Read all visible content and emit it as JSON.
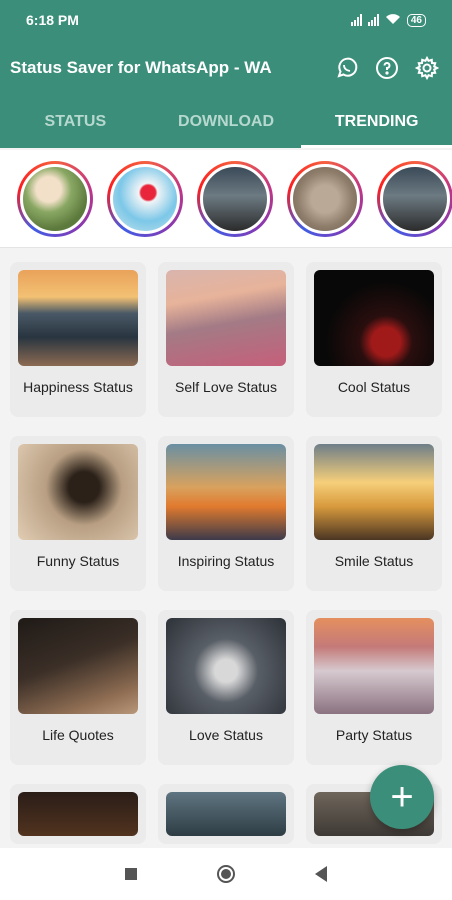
{
  "status_bar": {
    "time": "6:18 PM",
    "battery": "46"
  },
  "app": {
    "title": "Status Saver for WhatsApp - WA",
    "actions": [
      {
        "name": "whatsapp-icon"
      },
      {
        "name": "help-icon"
      },
      {
        "name": "settings-icon"
      }
    ]
  },
  "tabs": [
    {
      "label": "STATUS",
      "active": false
    },
    {
      "label": "DOWNLOAD",
      "active": false
    },
    {
      "label": "TRENDING",
      "active": true
    }
  ],
  "stories": [
    {
      "name": "story-1"
    },
    {
      "name": "story-2"
    },
    {
      "name": "story-3"
    },
    {
      "name": "story-4"
    },
    {
      "name": "story-5"
    }
  ],
  "categories": [
    {
      "label": "Happiness Status"
    },
    {
      "label": "Self Love Status"
    },
    {
      "label": "Cool Status"
    },
    {
      "label": "Funny Status"
    },
    {
      "label": "Inspiring Status"
    },
    {
      "label": "Smile Status"
    },
    {
      "label": "Life Quotes"
    },
    {
      "label": "Love Status"
    },
    {
      "label": "Party Status"
    }
  ],
  "fab": {
    "label": "+"
  },
  "colors": {
    "primary": "#3b8f7a",
    "active_tab": "#ffffff",
    "inactive_tab": "#b7d8cf"
  }
}
